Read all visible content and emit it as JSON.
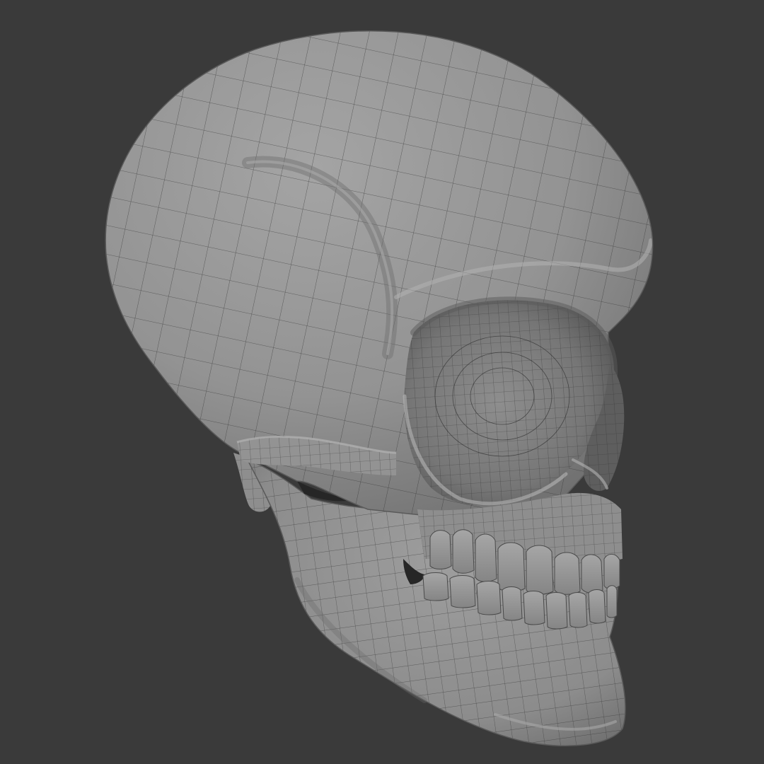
{
  "scene": {
    "subject": "skull-wireframe-render",
    "view": "three-quarter-right",
    "colors": {
      "background": "#3a3a3a",
      "model_light": "#9c9c9c",
      "model_mid": "#8a8a8a",
      "model_shadow": "#5c5c5c",
      "wire": "#2e2e2e",
      "socket_inner": "#6e6e6e",
      "gap_dark": "#262626"
    }
  }
}
